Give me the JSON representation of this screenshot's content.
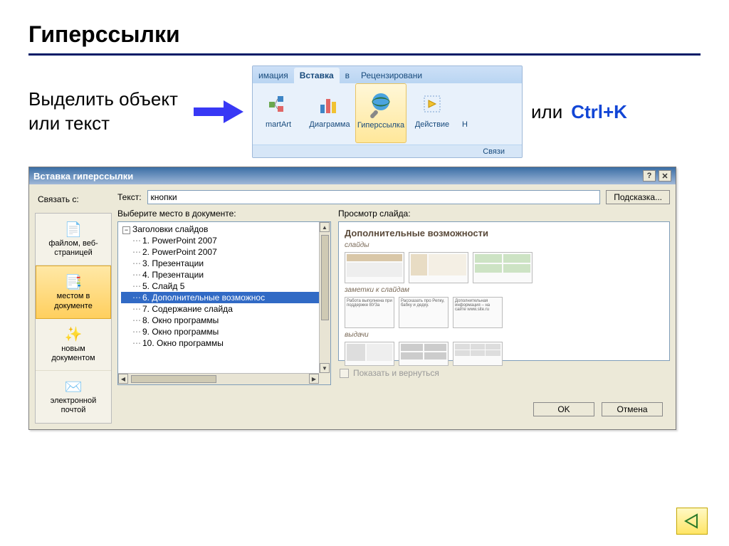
{
  "page_title": "Гиперссылки",
  "instruction": "Выделить объект или текст",
  "or_text": "или",
  "shortcut": "Ctrl+K",
  "ribbon": {
    "tabs": {
      "prev": "имация",
      "active": "Вставка",
      "mid": "в",
      "next": "Рецензировани"
    },
    "items": [
      {
        "label": "martArt"
      },
      {
        "label": "Диаграмма"
      },
      {
        "label": "Гиперссылка"
      },
      {
        "label": "Действие"
      },
      {
        "label": "Н"
      }
    ],
    "group": "Связи"
  },
  "dialog": {
    "title": "Вставка гиперссылки",
    "link_with": "Связать с:",
    "text_label": "Текст:",
    "text_value": "кнопки",
    "tooltip_btn": "Подсказка...",
    "left_items": [
      {
        "label_a": "файлом, веб-",
        "label_b": "страницей",
        "u": ""
      },
      {
        "label_a": "местом в",
        "label_b": "документе",
        "u": ""
      },
      {
        "label_a": "новым",
        "label_b": "документом",
        "u": "н"
      },
      {
        "label_a": "электронной",
        "label_b": "почтой",
        "u": "н"
      }
    ],
    "choose_label": "Выберите место в документе:",
    "preview_label": "Просмотр слайда:",
    "tree_root": "Заголовки слайдов",
    "tree_items": [
      "1. PowerPoint 2007",
      "2. PowerPoint 2007",
      "3. Презентации",
      "4. Презентации",
      "5. Слайд 5",
      "6. Дополнительные возможнос",
      "7. Содержание слайда",
      "8. Окно программы",
      "9. Окно программы",
      "10. Окно программы"
    ],
    "tree_selected_index": 5,
    "preview_title": "Дополнительные возможности",
    "preview_sections": [
      "слайды",
      "заметки к слайдам",
      "выдачи"
    ],
    "preview_note1": "Работа выполнена при поддержке ВУЗа",
    "preview_note2": "Рассказать про Репку, бабку и дедку.",
    "preview_note3": "Дополнительная информация – на сайте www.site.ru",
    "show_return": "Показать и вернуться",
    "ok": "OK",
    "cancel": "Отмена"
  }
}
